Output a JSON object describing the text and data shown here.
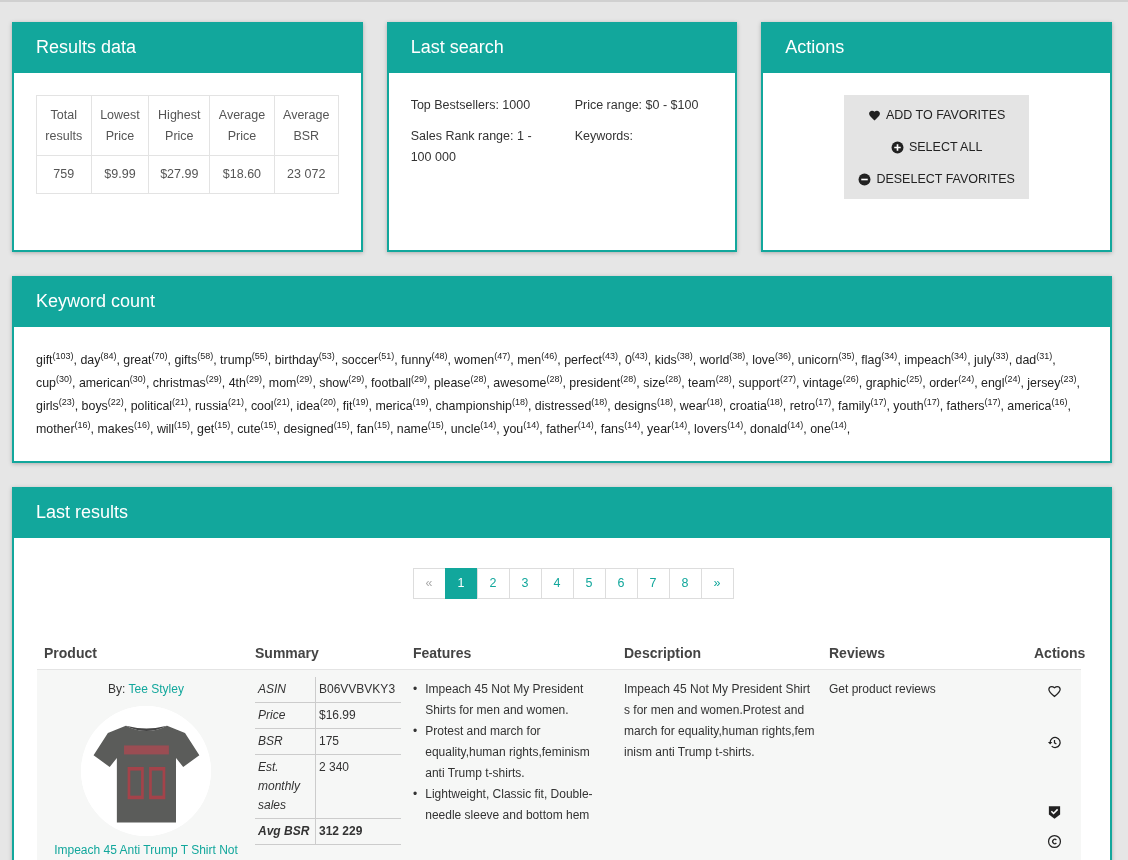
{
  "results_data": {
    "title": "Results data",
    "columns": [
      "Total results",
      "Lowest Price",
      "Highest Price",
      "Average Price",
      "Average BSR"
    ],
    "values": [
      "759",
      "$9.99",
      "$27.99",
      "$18.60",
      "23 072"
    ]
  },
  "last_search": {
    "title": "Last search",
    "fields": [
      "Top Bestsellers: 1000",
      "Price range: $0 - $100",
      "Sales Rank range: 1 - 100 000",
      "Keywords:"
    ]
  },
  "actions": {
    "title": "Actions",
    "buttons": [
      {
        "label": "ADD TO FAVORITES",
        "kind": "heart"
      },
      {
        "label": "SELECT ALL",
        "kind": "plus"
      },
      {
        "label": "DESELECT FAVORITES",
        "kind": "minus"
      }
    ]
  },
  "keyword_count": {
    "title": "Keyword count",
    "text": "gift$^{(103)}$, day$^{(84)}$, great$^{(70)}$, gifts$^{(58)}$, trump$^{(55)}$, birthday$^{(53)}$, soccer$^{(51)}$, funny$^{(48)}$, women$^{(47)}$, men$^{(46)}$, perfect$^{(43)}$, 0$^{(43)}$, kids$^{(38)}$, world$^{(38)}$, love$^{(36)}$, unicorn$^{(35)}$, flag$^{(34)}$, impeach$^{(34)}$, july$^{(33)}$, dad$^{(31)}$, cup$^{(30)}$, american$^{(30)}$, christmas$^{(29)}$, 4th$^{(29)}$, mom$^{(29)}$, show$^{(29)}$, football$^{(29)}$, please$^{(28)}$, awesome$^{(28)}$, president$^{(28)}$, size$^{(28)}$, team$^{(28)}$, support$^{(27)}$, vintage$^{(26)}$, graphic$^{(25)}$, order$^{(24)}$, engl$^{(24)}$, jersey$^{(23)}$, girls$^{(23)}$, boys$^{(22)}$, political$^{(21)}$, russia$^{(21)}$, cool$^{(21)}$, idea$^{(20)}$, fit$^{(19)}$, merica$^{(19)}$, championship$^{(18)}$, distressed$^{(18)}$, designs$^{(18)}$, wear$^{(18)}$, croatia$^{(18)}$, retro$^{(17)}$, family$^{(17)}$, youth$^{(17)}$, fathers$^{(17)}$, america$^{(16)}$, mother$^{(16)}$, makes$^{(16)}$, will$^{(15)}$, get$^{(15)}$, cute$^{(15)}$, designed$^{(15)}$, fan$^{(15)}$, name$^{(15)}$, uncle$^{(14)}$, you$^{(14)}$, father$^{(14)}$, fans$^{(14)}$, year$^{(14)}$, lovers$^{(14)}$, donald$^{(14)}$, one$^{(14)}$,"
  },
  "last_results": {
    "title": "Last results",
    "pagination": [
      {
        "label": "«",
        "selected": false,
        "disabled": true
      },
      {
        "label": "1",
        "selected": true,
        "disabled": false
      },
      {
        "label": "2",
        "selected": false,
        "disabled": false
      },
      {
        "label": "3",
        "selected": false,
        "disabled": false
      },
      {
        "label": "4",
        "selected": false,
        "disabled": false
      },
      {
        "label": "5",
        "selected": false,
        "disabled": false
      },
      {
        "label": "6",
        "selected": false,
        "disabled": false
      },
      {
        "label": "7",
        "selected": false,
        "disabled": false
      },
      {
        "label": "8",
        "selected": false,
        "disabled": false
      },
      {
        "label": "»",
        "selected": false,
        "disabled": false
      }
    ],
    "columns": [
      "Product",
      "Summary",
      "Features",
      "Description",
      "Reviews",
      "Actions"
    ],
    "rows": [
      {
        "by_label": "By:",
        "author": "Tee Styley",
        "product_title": "Impeach 45 Anti Trump T Shirt Not",
        "summary": [
          {
            "label": "ASIN",
            "value": "B06VVBVKY3"
          },
          {
            "label": "Price",
            "value": "$16.99"
          },
          {
            "label": "BSR",
            "value": "175"
          },
          {
            "label": "Est. monthly sales",
            "value": "2 340"
          },
          {
            "label": "Avg BSR",
            "value": "312 229",
            "kind": "bold"
          }
        ],
        "features": [
          {
            "bullet": "•",
            "text": "Impeach 45 Not My President Shirts for men and women."
          },
          {
            "bullet": "•",
            "text": "Protest and march for equality,human rights,feminism anti Trump t-shirts."
          },
          {
            "bullet": "•",
            "text": "Lightweight, Classic fit, Double-needle sleeve and bottom hem"
          }
        ],
        "description": "Impeach 45 Not My President Shirts for men and women.Protest and march for equality,human rights,feminism anti Trump t-shirts.",
        "reviews": "Get product reviews",
        "actions": [
          {
            "kind": "favorite"
          },
          {
            "kind": "history"
          },
          {
            "kind": "verified"
          },
          {
            "kind": "copyright"
          }
        ]
      }
    ]
  }
}
